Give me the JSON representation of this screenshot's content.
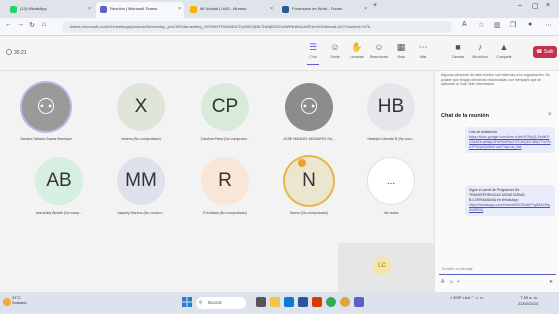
{
  "browser": {
    "tabs": [
      {
        "title": "(13) WhatsApp",
        "color": "#25d366"
      },
      {
        "title": "Reunión | Microsoft Teams",
        "color": "#5b5fc7",
        "active": true
      },
      {
        "title": "Mi Unidad | UAS - Alumno",
        "color": "#f4b400"
      },
      {
        "title": "Formulario en Word - Formu",
        "color": "#2b579a"
      }
    ],
    "url": "teams.microsoft.com/v2/meetings/join/uuid/5c/meetup_join/19%3ameeting_OGRhNTFhNWEtZTIxZi00Zjk5LThkNjEtZGIxNWNhNzUzMTdm%40thread.v2/0?context=%7b"
  },
  "toolbar": {
    "timer": "35:21",
    "buttons": [
      {
        "icon": "chat-icon",
        "glyph": "☰",
        "label": "Chat"
      },
      {
        "icon": "people-icon",
        "glyph": "☺",
        "label": "Gente"
      },
      {
        "icon": "raise-hand-icon",
        "glyph": "✋",
        "label": "Levantar"
      },
      {
        "icon": "reactions-icon",
        "glyph": "☺",
        "label": "Reacciones"
      },
      {
        "icon": "view-icon",
        "glyph": "▦",
        "label": "Vista"
      },
      {
        "icon": "more-icon",
        "glyph": "⋯",
        "label": "Más"
      },
      {
        "icon": "camera-icon",
        "glyph": "■",
        "label": "Cámara"
      },
      {
        "icon": "mic-icon",
        "glyph": "♪",
        "label": "Micrófono"
      },
      {
        "icon": "share-icon",
        "glyph": "▲",
        "label": "Compartir"
      }
    ],
    "leave_label": "Salir"
  },
  "participants": [
    {
      "initials": "",
      "name": "Samara Tatiana Guaza Manrique",
      "bg": "#9a9a9a",
      "style": "ring",
      "photo": true
    },
    {
      "initials": "X",
      "name": "ximena (No comprobado)",
      "bg": "#dfe6d9"
    },
    {
      "initials": "CP",
      "name": "Carolina Parra (No comproba...",
      "bg": "#d8ead9"
    },
    {
      "initials": "",
      "name": "JOSE MANUEL MONARES SA...",
      "bg": "#8c8c8c",
      "photo": true
    },
    {
      "initials": "HB",
      "name": "Hadelyn Liberate B (No com...",
      "bg": "#e6e6ea"
    },
    {
      "initials": "AB",
      "name": "ana teddy Bicarte (No comp...",
      "bg": "#d6efe1"
    },
    {
      "initials": "MM",
      "name": "mayerly Moreno (No comcro...",
      "bg": "#dfe2ec"
    },
    {
      "initials": "R",
      "name": "R invitado (No comprobado)",
      "bg": "#f8e6d8"
    },
    {
      "initials": "N",
      "name": "Nuevo (No comprobado)",
      "bg": "#ece6d0",
      "style": "speak",
      "hand": true
    },
    {
      "initials": "...",
      "name": "Ver todos",
      "bg": "#ffffff"
    }
  ],
  "self_tile": {
    "initials": "LC"
  },
  "chat": {
    "notice": "Algunas personas de esta reunión son externas a su organización. Es posible que tengan directivas relacionadas con mensajes que se aplicarán al chat. Más información.",
    "title": "Chat de la reunión",
    "messages": [
      {
        "text": "Link de asistencia",
        "link": "https://docs.google.com/form s/d/e/1FAIpQLSeMKDC9zAZb zkWqn1PzR5nPNoTG7OeQbX f86p7TmTNaYPSxyvQ/viewf orm?usp=sf_link"
      },
      {
        "text": "Sigue el canal de Programas De TRANSFERENCIAS MONETARIAS B.CORRAMANIA en WhatsApp:",
        "link": "https://whatsapp.com/channel/0029VaKPhy8ALlH0q0Vl8R0Q"
      }
    ],
    "compose_placeholder": "Escribir un mensaje"
  },
  "taskbar": {
    "weather_temp": "31°C",
    "weather_desc": "Soleado",
    "search_label": "Buscar",
    "lang": "ESP LAA",
    "time": "7:59 a. m.",
    "date": "22/02/2024"
  }
}
